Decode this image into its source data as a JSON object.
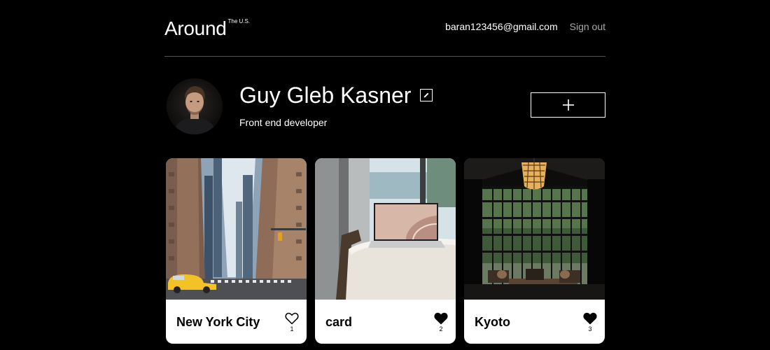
{
  "header": {
    "logo_text": "Around",
    "logo_superscript": "The U.S.",
    "user_email": "baran123456@gmail.com",
    "signout_label": "Sign out"
  },
  "profile": {
    "name": "Guy Gleb Kasner",
    "about": "Front end developer",
    "edit_icon": "pencil-icon",
    "add_icon": "plus-icon"
  },
  "cards": [
    {
      "title": "New York City",
      "likes": "1",
      "liked": false,
      "image": "city-street-photo"
    },
    {
      "title": "card",
      "likes": "2",
      "liked": true,
      "image": "laptop-on-chair-photo"
    },
    {
      "title": "Kyoto",
      "likes": "3",
      "liked": true,
      "image": "kyoto-interior-photo"
    }
  ],
  "colors": {
    "background": "#000000",
    "card_background": "#ffffff",
    "divider": "#545454",
    "muted_text": "#a9a9a9"
  }
}
